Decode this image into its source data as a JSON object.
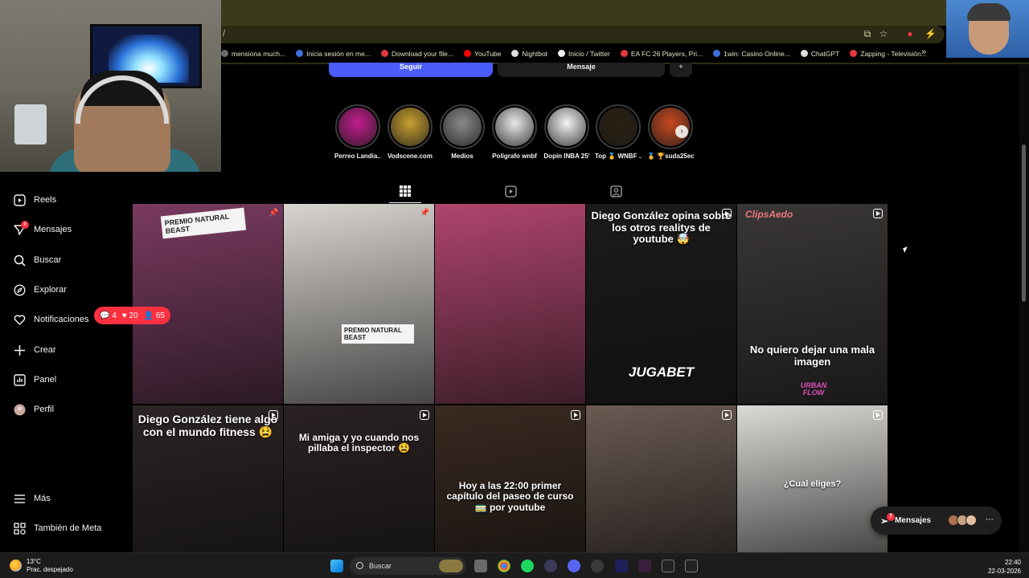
{
  "browser": {
    "url_fragment": "/",
    "bookmarks": [
      {
        "label": "mensiona much...",
        "color": "#6b6b6b"
      },
      {
        "label": "Inicia sesión en me...",
        "color": "#3d6fd9"
      },
      {
        "label": "Download your file...",
        "color": "#e0393e"
      },
      {
        "label": "YouTube",
        "color": "#ff0000"
      },
      {
        "label": "Nightbot",
        "color": "#dddddd"
      },
      {
        "label": "Inicio / Twitter",
        "color": "#eeeeee"
      },
      {
        "label": "EA FC 26 Players, Pri...",
        "color": "#e0393e"
      },
      {
        "label": "1win: Casino Online...",
        "color": "#3d6fd9"
      },
      {
        "label": "ChatGPT",
        "color": "#dddddd"
      },
      {
        "label": "Zapping - Televisión...",
        "color": "#e0393e"
      }
    ],
    "more": "»"
  },
  "profile": {
    "follow_label": "Seguir",
    "message_label": "Mensaje",
    "add_label": "+"
  },
  "highlights": [
    {
      "label": "Perreo Landia...",
      "color": "#c21d8c"
    },
    {
      "label": "Vodscene.com",
      "color": "#c8a030"
    },
    {
      "label": "Medios",
      "color": "#8a8a8a"
    },
    {
      "label": "Poligrafo wnbf",
      "color": "#e9e9e9"
    },
    {
      "label": "Dopin INBA 25'",
      "color": "#f4f4f4"
    },
    {
      "label": "Top 🥇 WNBF ...",
      "color": "#2b2010"
    },
    {
      "label": "🥇 🏆suda25ec",
      "color": "#c84a20"
    }
  ],
  "sidebar": {
    "items": [
      {
        "label": "Reels",
        "icon": "reels-icon"
      },
      {
        "label": "Mensajes",
        "icon": "messages-icon",
        "badge": "8"
      },
      {
        "label": "Buscar",
        "icon": "search-icon"
      },
      {
        "label": "Explorar",
        "icon": "explore-icon"
      },
      {
        "label": "Notificaciones",
        "icon": "heart-icon"
      },
      {
        "label": "Crear",
        "icon": "plus-icon"
      },
      {
        "label": "Panel",
        "icon": "dashboard-icon"
      },
      {
        "label": "Perfil",
        "icon": "avatar-icon"
      },
      {
        "label": "Más",
        "icon": "menu-icon"
      },
      {
        "label": "También de Meta",
        "icon": "meta-icon"
      }
    ],
    "notif_pill": {
      "comments": "4",
      "likes": "20",
      "follows": "65"
    }
  },
  "tabs": [
    {
      "name": "grid-icon",
      "active": true
    },
    {
      "name": "reels-tab-icon",
      "active": false
    },
    {
      "name": "tagged-icon",
      "active": false
    }
  ],
  "posts": [
    {
      "caption": "",
      "overlay": "PREMIO NATURAL BEAST",
      "type": "pinned",
      "bg": "#7a3a60"
    },
    {
      "caption": "",
      "overlay": "PREMIO NATURAL BEAST",
      "type": "pinned",
      "bg": "#d8d4cf"
    },
    {
      "caption": "",
      "overlay": "",
      "type": "photo",
      "bg": "#b0456e"
    },
    {
      "caption": "Diego González opina sobre los otros realitys de youtube 🤯",
      "overlay": "JUGABET",
      "type": "reel",
      "bg": "#1b1b1b"
    },
    {
      "caption": "No quiero dejar una mala imagen",
      "overlay": "ClipsAedo",
      "overlay2": "URBAN FLOW",
      "type": "reel",
      "bg": "#3a3636"
    },
    {
      "caption": "Diego González tiene algo con el mundo fitness 😫",
      "overlay": "",
      "type": "reel",
      "bg": "#2c2424"
    },
    {
      "caption": "Mi amiga y yo cuando nos pillaba el inspector 😫",
      "overlay": "",
      "type": "reel",
      "bg": "#2a2222"
    },
    {
      "caption": "Hoy a las 22:00 primer capítulo del paseo de curso 🚃 por youtube",
      "overlay": "",
      "type": "reel",
      "bg": "#3a2a20"
    },
    {
      "caption": "",
      "overlay": "",
      "type": "reel",
      "bg": "#6a5a52"
    },
    {
      "caption": "¿Cual eliges?",
      "overlay": "",
      "type": "reel",
      "bg": "#dcdad6"
    }
  ],
  "messages_pill": {
    "label": "Mensajes",
    "badge": "7"
  },
  "taskbar": {
    "temperature": "13°C",
    "weather": "Prac. despejado",
    "search": "Buscar",
    "time": "22:40",
    "date": "22-03-2026"
  }
}
